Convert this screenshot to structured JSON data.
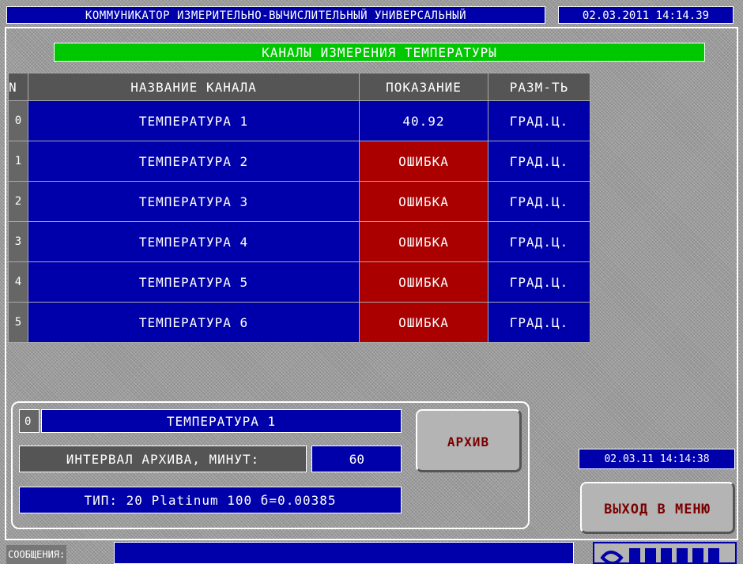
{
  "header": {
    "title": "КОММУНИКАТОР ИЗМЕРИТЕЛЬНО-ВЫЧИСЛИТЕЛЬНЫЙ УНИВЕРСАЛЬНЫЙ",
    "datetime": "02.03.2011 14:14.39"
  },
  "section_title": "КАНАЛЫ ИЗМЕРЕНИЯ ТЕМПЕРАТУРЫ",
  "table": {
    "headers": {
      "index": "N",
      "name": "НАЗВАНИЕ КАНАЛА",
      "value": "ПОКАЗАНИЕ",
      "unit": "РАЗМ-ТЬ"
    },
    "rows": [
      {
        "index": "0",
        "name": "ТЕМПЕРАТУРА 1",
        "value": "40.92",
        "status": "ok",
        "unit": "ГРАД.Ц."
      },
      {
        "index": "1",
        "name": "ТЕМПЕРАТУРА 2",
        "value": "ОШИБКА",
        "status": "error",
        "unit": "ГРАД.Ц."
      },
      {
        "index": "2",
        "name": "ТЕМПЕРАТУРА 3",
        "value": "ОШИБКА",
        "status": "error",
        "unit": "ГРАД.Ц."
      },
      {
        "index": "3",
        "name": "ТЕМПЕРАТУРА 4",
        "value": "ОШИБКА",
        "status": "error",
        "unit": "ГРАД.Ц."
      },
      {
        "index": "4",
        "name": "ТЕМПЕРАТУРА 5",
        "value": "ОШИБКА",
        "status": "error",
        "unit": "ГРАД.Ц."
      },
      {
        "index": "5",
        "name": "ТЕМПЕРАТУРА 6",
        "value": "ОШИБКА",
        "status": "error",
        "unit": "ГРАД.Ц."
      }
    ]
  },
  "detail_panel": {
    "index": "0",
    "name": "ТЕМПЕРАТУРА 1",
    "interval_label": "ИНТЕРВАЛ АРХИВА, МИНУТ:",
    "interval_value": "60",
    "type": "ТИП: 20 Platinum 100 б=0.00385"
  },
  "buttons": {
    "archive": "АРХИВ",
    "exit": "ВЫХОД В МЕНЮ"
  },
  "footer": {
    "datetime": "02.03.11 14:14:38",
    "messages_label": "СООБЩЕНИЯ:",
    "messages_value": ""
  },
  "colors": {
    "panel_blue": "#0000aa",
    "error_red": "#aa0000",
    "title_green": "#00c800",
    "button_text": "#7a0000"
  },
  "icons": {
    "logo": "vendor-logo"
  }
}
